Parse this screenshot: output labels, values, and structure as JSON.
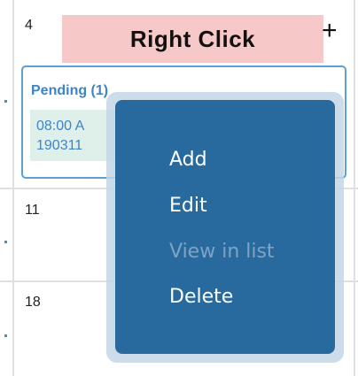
{
  "calendar": {
    "days": [
      "4",
      "11",
      "18"
    ],
    "banner_label": "Right Click",
    "add_icon_label": "+",
    "pending": {
      "title": "Pending (1)",
      "event_time": "08:00 A",
      "event_code": "190311"
    }
  },
  "context_menu": {
    "items": [
      {
        "label": "Add",
        "enabled": true
      },
      {
        "label": "Edit",
        "enabled": true
      },
      {
        "label": "View in list",
        "enabled": false
      },
      {
        "label": "Delete",
        "enabled": true
      }
    ]
  },
  "colors": {
    "menu_bg": "#286a9e",
    "banner_bg": "#f6c8c8",
    "pending_accent": "#3d85c6",
    "event_bg": "#dff0ea"
  }
}
